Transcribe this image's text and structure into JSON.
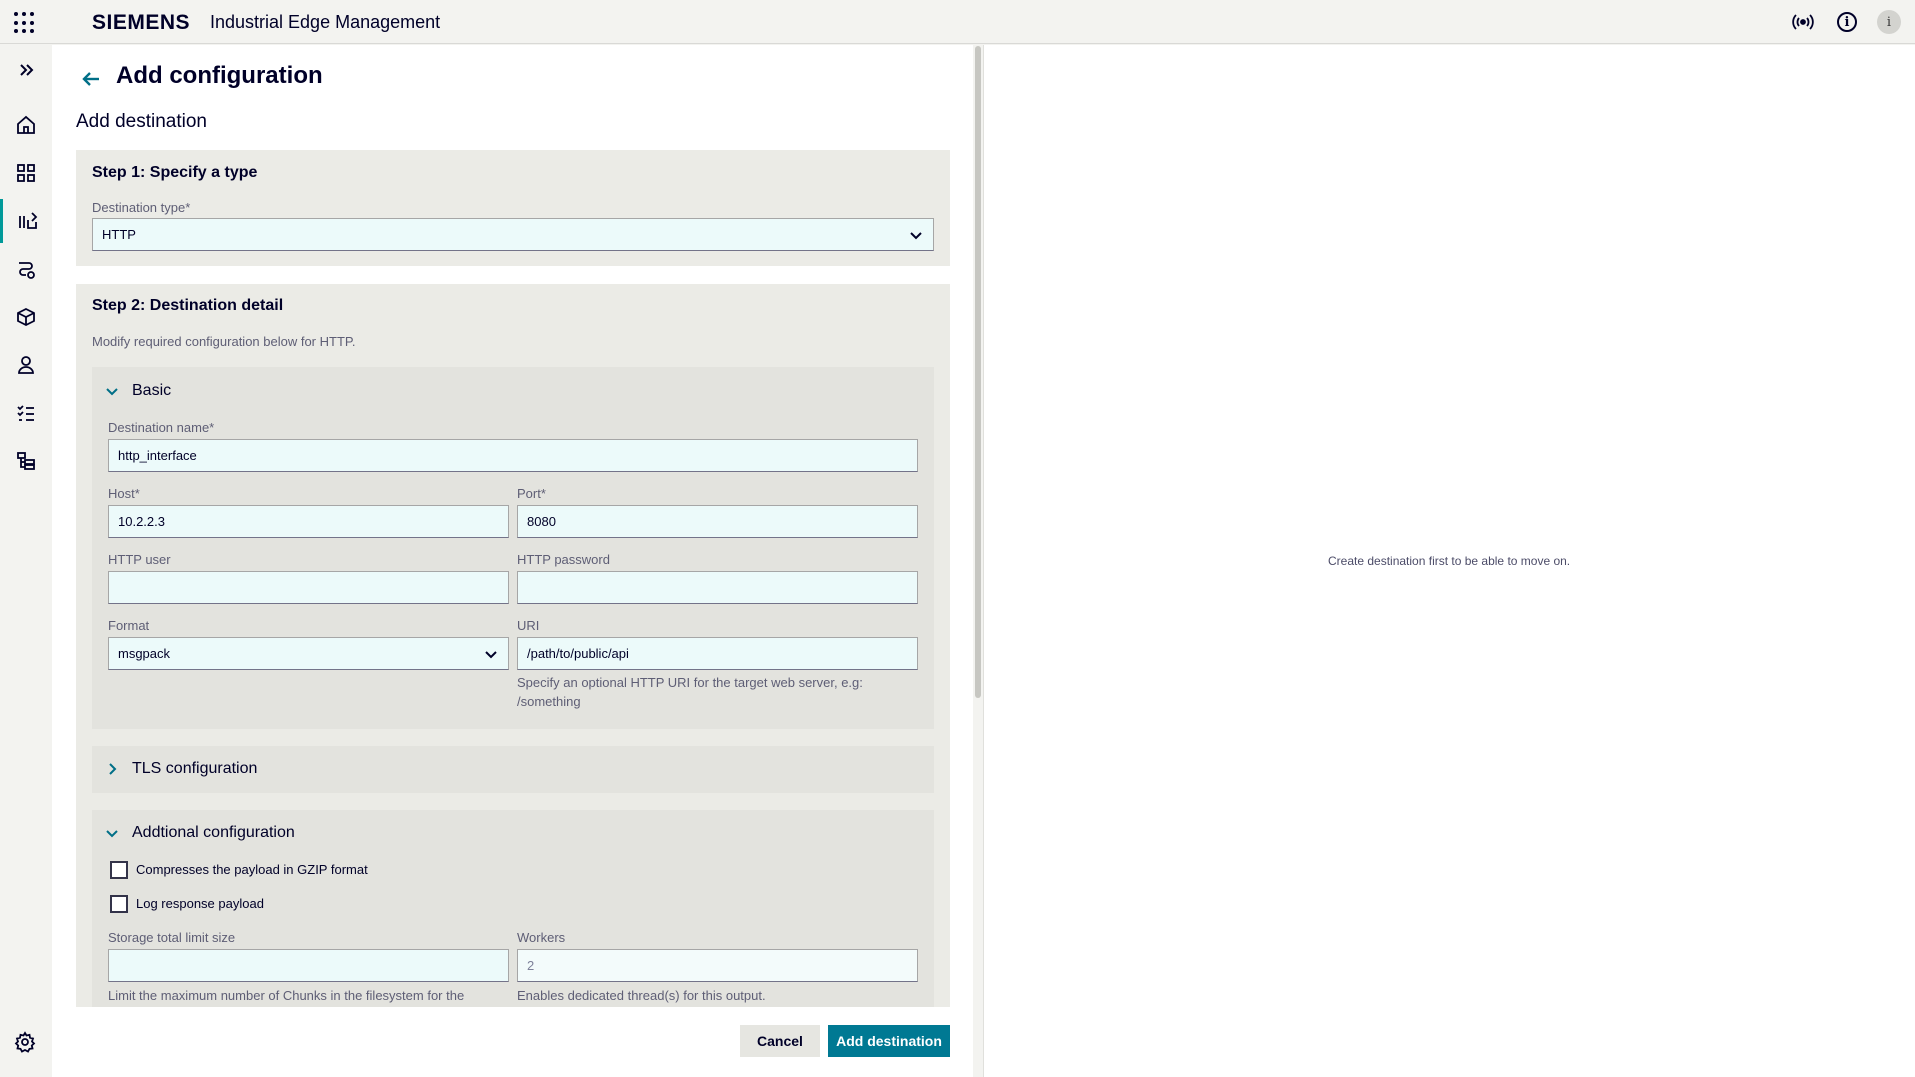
{
  "header": {
    "brand": "SIEMENS",
    "product": "Industrial Edge Management",
    "avatar_initial": "i"
  },
  "page": {
    "title": "Add configuration",
    "subtitle": "Add destination"
  },
  "step1": {
    "title": "Step 1: Specify a type",
    "type_label": "Destination type*",
    "type_value": "HTTP"
  },
  "step2": {
    "title": "Step 2: Destination detail",
    "description": "Modify required configuration below for HTTP.",
    "basic": {
      "title": "Basic",
      "name_label": "Destination name*",
      "name_value": "http_interface",
      "host_label": "Host*",
      "host_value": "10.2.2.3",
      "port_label": "Port*",
      "port_value": "8080",
      "user_label": "HTTP user",
      "user_value": "",
      "password_label": "HTTP password",
      "password_value": "",
      "format_label": "Format",
      "format_value": "msgpack",
      "uri_label": "URI",
      "uri_value": "/path/to/public/api",
      "uri_hint": "Specify an optional HTTP URI for the target web server, e.g: /something"
    },
    "tls": {
      "title": "TLS configuration"
    },
    "additional": {
      "title": "Addtional configuration",
      "gzip_label": "Compresses the payload in GZIP format",
      "log_label": "Log response payload",
      "storage_label": "Storage total limit size",
      "storage_value": "",
      "storage_hint": "Limit the maximum number of Chunks in the filesystem for the",
      "workers_label": "Workers",
      "workers_value": "2",
      "workers_hint": "Enables dedicated thread(s) for this output."
    }
  },
  "actions": {
    "cancel": "Cancel",
    "add": "Add destination"
  },
  "right_panel": {
    "message": "Create destination first to be able to move on."
  }
}
